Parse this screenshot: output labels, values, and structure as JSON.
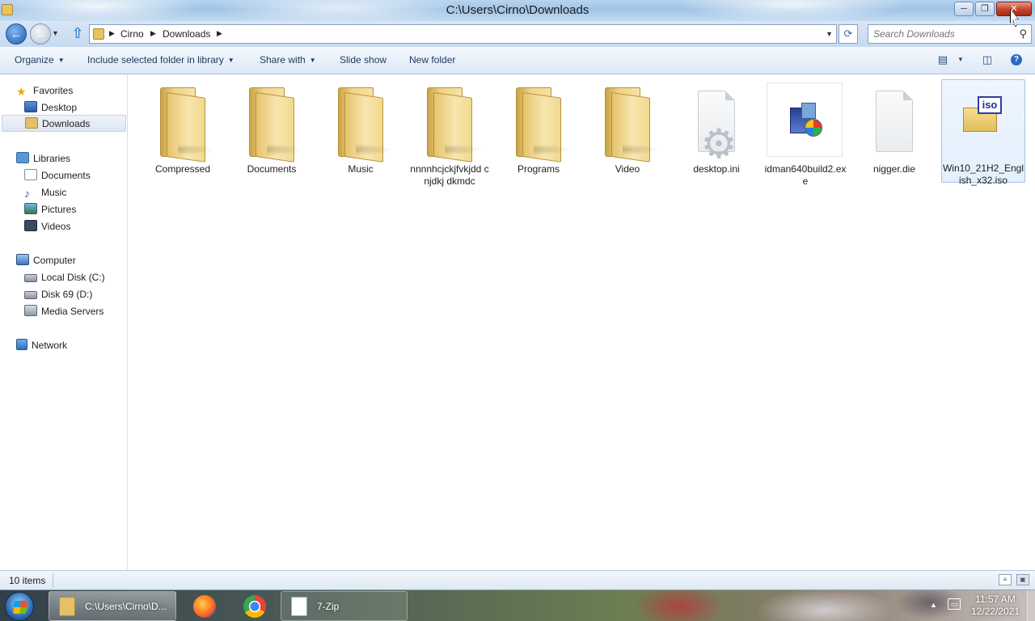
{
  "window": {
    "title": "C:\\Users\\Cirno\\Downloads",
    "minimize": "─",
    "maximize": "❐",
    "close": "✕"
  },
  "nav": {
    "back": "←",
    "forward": "→",
    "up": "⇧",
    "breadcrumbs": [
      "Cirno",
      "Downloads"
    ],
    "refresh": "⟳",
    "search_placeholder": "Search Downloads"
  },
  "toolbar": {
    "organize": "Organize",
    "include_library": "Include selected folder in library",
    "share_with": "Share with",
    "slide_show": "Slide show",
    "new_folder": "New folder"
  },
  "sidebar": {
    "favorites": "Favorites",
    "desktop": "Desktop",
    "downloads": "Downloads",
    "libraries": "Libraries",
    "documents": "Documents",
    "music": "Music",
    "pictures": "Pictures",
    "videos": "Videos",
    "computer": "Computer",
    "local_disk": "Local Disk (C:)",
    "disk69": "Disk 69 (D:)",
    "media_servers": "Media Servers",
    "network": "Network"
  },
  "files": [
    {
      "name": "Compressed",
      "type": "folder"
    },
    {
      "name": "Documents",
      "type": "folder"
    },
    {
      "name": "Music",
      "type": "folder"
    },
    {
      "name": "nnnnhcjckjfvkjdd cnjdkj dkmdc",
      "type": "folder"
    },
    {
      "name": "Programs",
      "type": "folder"
    },
    {
      "name": "Video",
      "type": "folder"
    },
    {
      "name": "desktop.ini",
      "type": "settings-file"
    },
    {
      "name": "idman640build2.exe",
      "type": "exe"
    },
    {
      "name": "nigger.die",
      "type": "blank-file"
    },
    {
      "name": "Win10_21H2_English_x32.iso",
      "type": "iso",
      "selected": true
    }
  ],
  "iso_badge": "iso",
  "status": {
    "item_count": "10 items"
  },
  "taskbar": {
    "explorer_label": "C:\\Users\\Cirno\\D...",
    "zip_label": "7-Zip",
    "time": "11:57 AM",
    "date": "12/22/2021"
  },
  "colors": {
    "titlebar": "#b8d4ee",
    "close_button": "#c2432a",
    "command_text": "#1e395b",
    "selection_border": "#a3c4ea"
  }
}
